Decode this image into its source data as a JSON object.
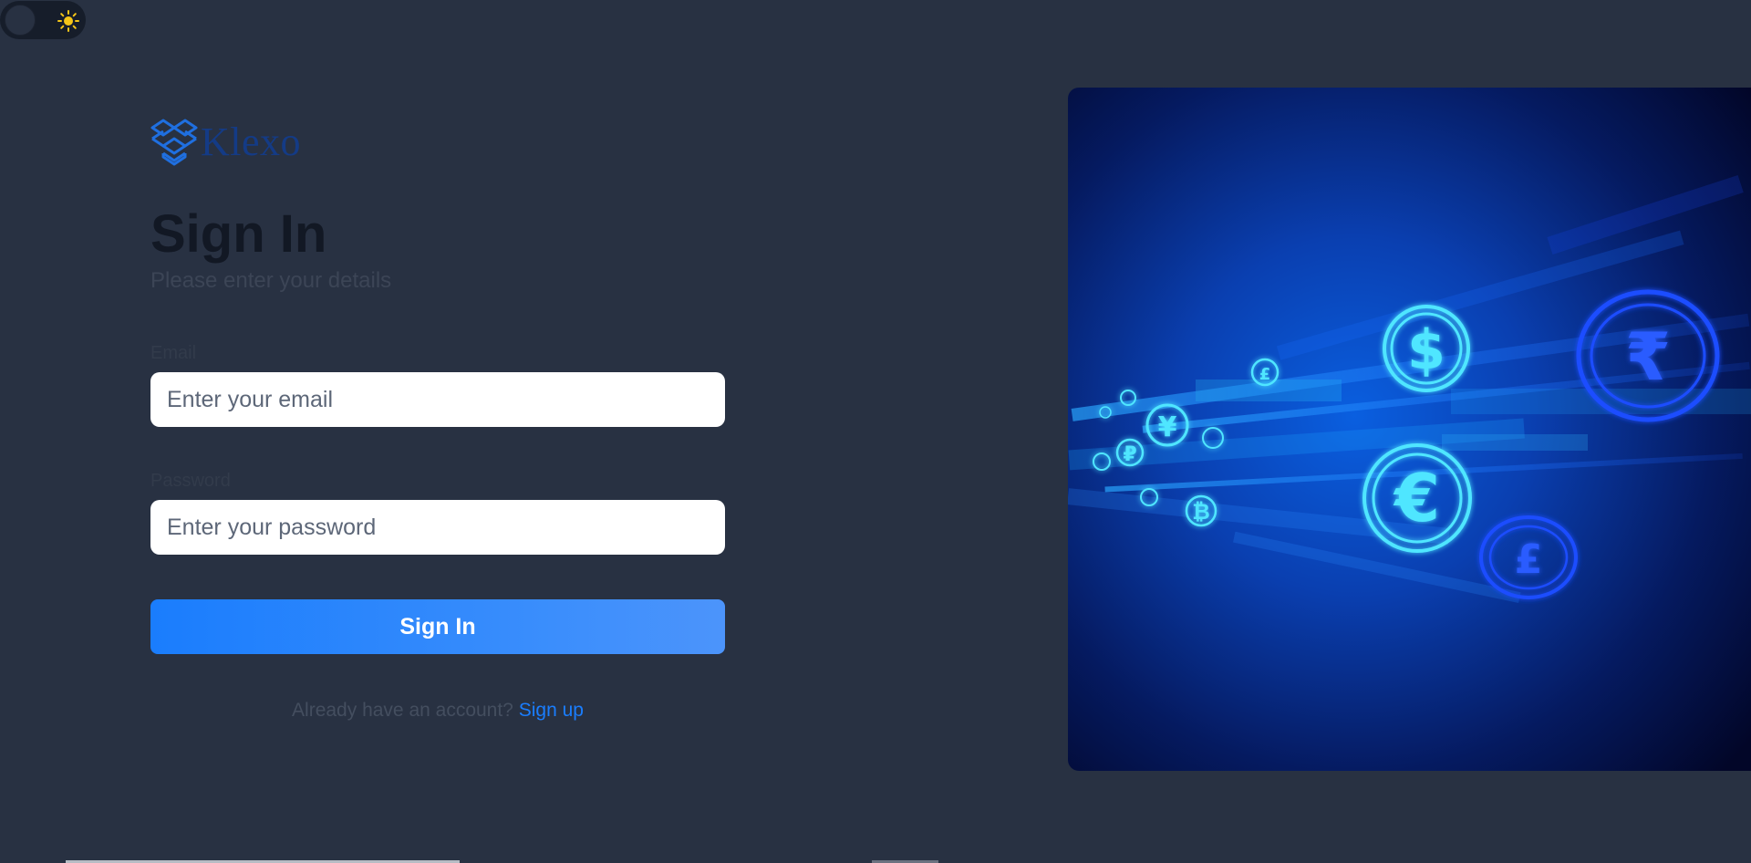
{
  "theme_toggle": {
    "icon": "sun-icon",
    "accent": "#f5c518"
  },
  "brand": {
    "name": "Klexo",
    "color": "#143b86"
  },
  "heading": {
    "title": "Sign In",
    "subtitle": "Please enter your details"
  },
  "form": {
    "email": {
      "label": "Email",
      "placeholder": "Enter your email",
      "value": ""
    },
    "password": {
      "label": "Password",
      "placeholder": "Enter your password",
      "value": ""
    },
    "submit_label": "Sign In"
  },
  "footer": {
    "prompt": "Already have an account?",
    "link_label": "Sign up"
  },
  "hero": {
    "symbols": [
      "$",
      "₹",
      "€",
      "£",
      "¥",
      "₽",
      "₿",
      "₣",
      "£",
      "₱"
    ]
  },
  "colors": {
    "background": "#283142",
    "primary": "#1a7dfd",
    "input_bg": "#ffffff"
  }
}
